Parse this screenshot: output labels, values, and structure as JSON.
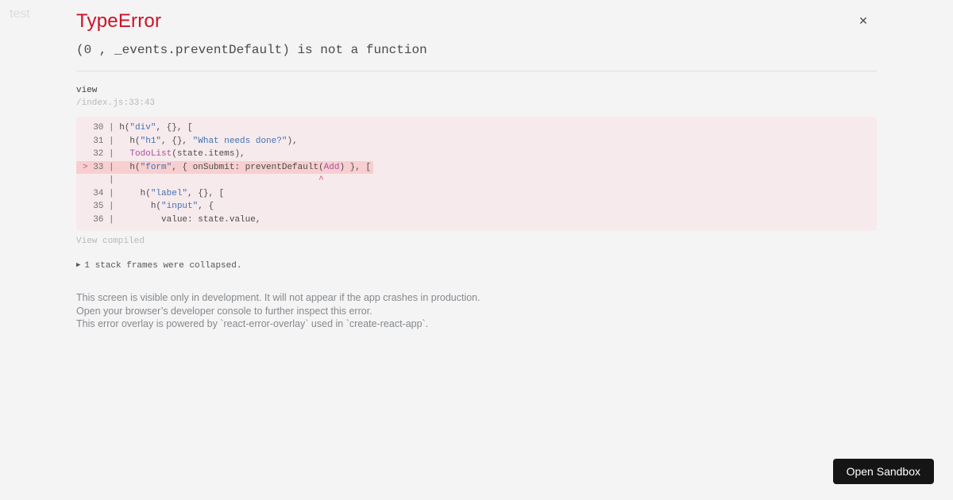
{
  "page": {
    "background_text": "test"
  },
  "overlay": {
    "title": "TypeError",
    "message": "(0 , _events.preventDefault) is not a function",
    "close_label": "✕",
    "frame": {
      "function_name": "view",
      "location": "/index.js:33:43"
    },
    "code": {
      "lines": [
        {
          "highlight": false,
          "segments": [
            {
              "text": "  30 | ",
              "type": "ln"
            },
            {
              "text": "h(",
              "type": "code"
            },
            {
              "text": "\"div\"",
              "type": "str"
            },
            {
              "text": ", {}, [",
              "type": "code"
            }
          ]
        },
        {
          "highlight": false,
          "segments": [
            {
              "text": "  31 | ",
              "type": "ln"
            },
            {
              "text": "  h(",
              "type": "code"
            },
            {
              "text": "\"h1\"",
              "type": "str"
            },
            {
              "text": ", {}, ",
              "type": "code"
            },
            {
              "text": "\"What needs done?\"",
              "type": "str"
            },
            {
              "text": "),",
              "type": "code"
            }
          ]
        },
        {
          "highlight": false,
          "segments": [
            {
              "text": "  32 | ",
              "type": "ln"
            },
            {
              "text": "  ",
              "type": "code"
            },
            {
              "text": "TodoList",
              "type": "fn"
            },
            {
              "text": "(state.items),",
              "type": "code"
            }
          ]
        },
        {
          "highlight": true,
          "segments": [
            {
              "text": "> ",
              "type": "mark"
            },
            {
              "text": "33 | ",
              "type": "ln"
            },
            {
              "text": "  h(",
              "type": "code"
            },
            {
              "text": "\"form\"",
              "type": "str"
            },
            {
              "text": ", { onSubmit: preventDefault(",
              "type": "code"
            },
            {
              "text": "Add",
              "type": "fn"
            },
            {
              "text": ") }, [",
              "type": "code"
            }
          ]
        },
        {
          "highlight": false,
          "segments": [
            {
              "text": "     | ",
              "type": "ln"
            },
            {
              "text": "                                      ",
              "type": "code"
            },
            {
              "text": "^",
              "type": "caret"
            }
          ]
        },
        {
          "highlight": false,
          "segments": [
            {
              "text": "  34 | ",
              "type": "ln"
            },
            {
              "text": "    h(",
              "type": "code"
            },
            {
              "text": "\"label\"",
              "type": "str"
            },
            {
              "text": ", {}, [",
              "type": "code"
            }
          ]
        },
        {
          "highlight": false,
          "segments": [
            {
              "text": "  35 | ",
              "type": "ln"
            },
            {
              "text": "      h(",
              "type": "code"
            },
            {
              "text": "\"input\"",
              "type": "str"
            },
            {
              "text": ", {",
              "type": "code"
            }
          ]
        },
        {
          "highlight": false,
          "segments": [
            {
              "text": "  36 | ",
              "type": "ln"
            },
            {
              "text": "        value: state.value,",
              "type": "code"
            }
          ]
        }
      ]
    },
    "view_compiled_label": "View compiled",
    "collapse": {
      "icon": "▶",
      "label": "1 stack frames were collapsed."
    },
    "footer_lines": [
      "This screen is visible only in development. It will not appear if the app crashes in production.",
      "Open your browser’s developer console to further inspect this error.",
      "This error overlay is powered by `react-error-overlay` used in `create-react-app`."
    ]
  },
  "sandbox": {
    "open_button_label": "Open Sandbox"
  },
  "colors": {
    "error_red": "#ce1126",
    "code_bg": "#f7eaec",
    "highlight_bg": "#f8cfd0",
    "string_blue": "#4173b4",
    "fn_magenta": "#a9509b",
    "marker_pink": "#cf4a87",
    "button_bg": "#151515"
  }
}
